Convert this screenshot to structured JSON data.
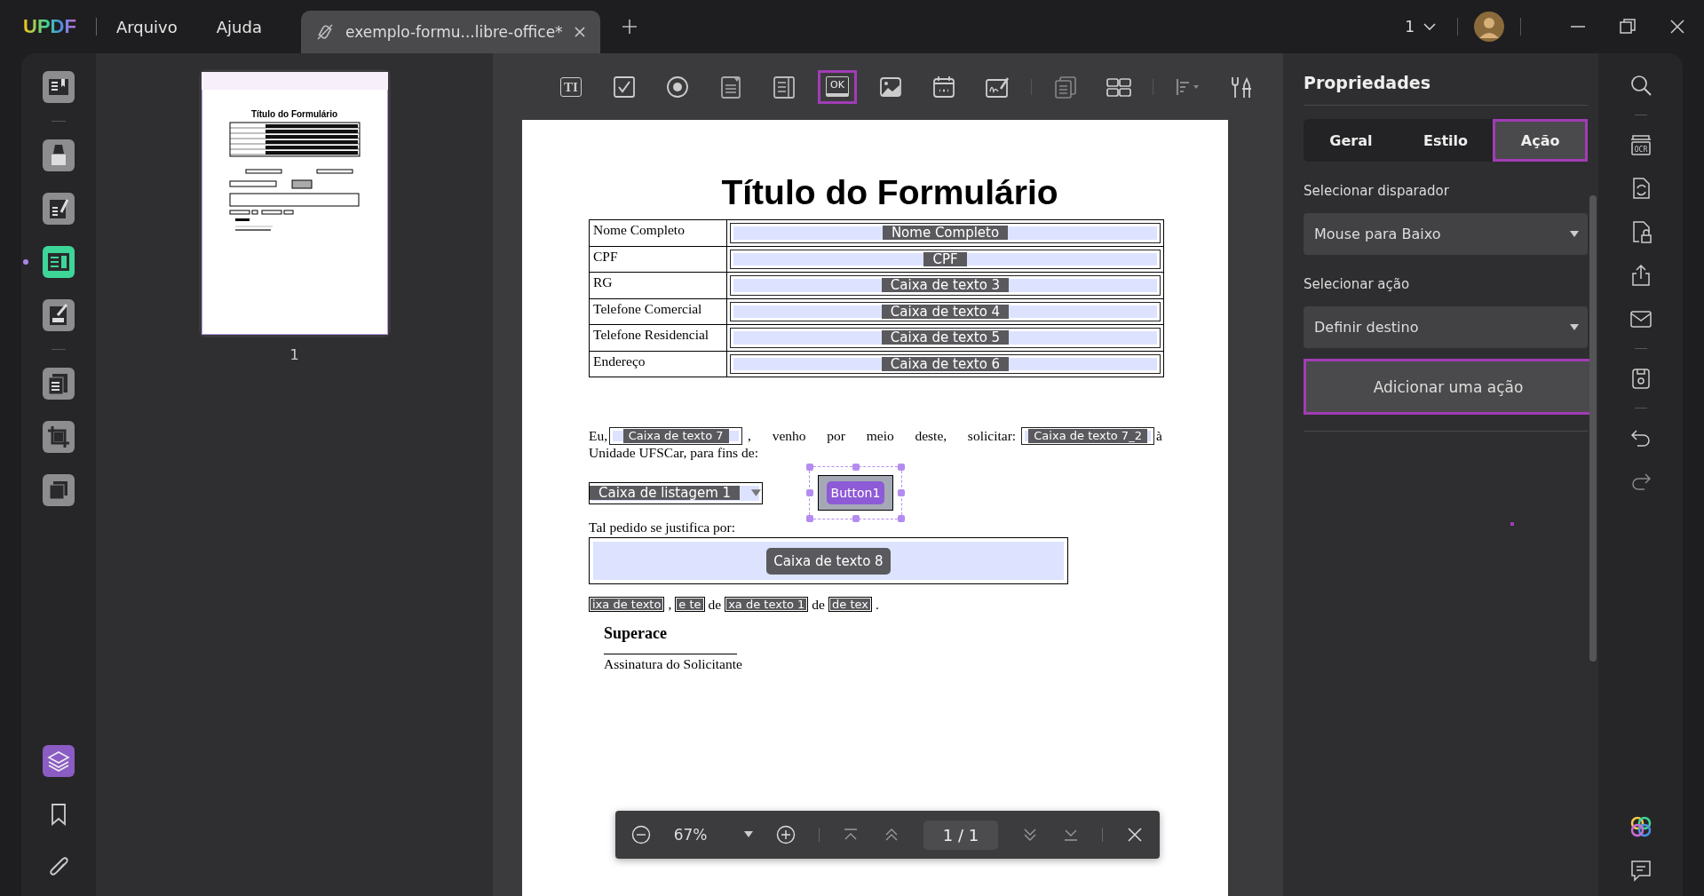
{
  "app": {
    "logo": "UPDF",
    "menu": [
      "Arquivo",
      "Ajuda"
    ]
  },
  "tabs": [
    {
      "title": "exemplo-formu...libre-office*",
      "selected": true
    }
  ],
  "window_count": "1",
  "left_tools": [
    {
      "kind": "reader",
      "selected": false
    },
    {
      "kind": "highlighter",
      "selected": false
    },
    {
      "kind": "edit",
      "selected": false
    },
    {
      "kind": "form",
      "selected": true
    },
    {
      "kind": "fill-sign",
      "selected": false
    },
    {
      "kind": "organize",
      "selected": false
    },
    {
      "kind": "crop",
      "selected": false
    },
    {
      "kind": "pages",
      "selected": false
    }
  ],
  "left_bottom_tools": [
    {
      "kind": "layers",
      "selected": true
    },
    {
      "kind": "bookmark",
      "selected": false
    },
    {
      "kind": "attachment",
      "selected": false
    }
  ],
  "thumbnails": [
    {
      "title": "Título do Formulário",
      "label": "1",
      "selected": true
    }
  ],
  "form_tools": [
    {
      "kind": "text-field",
      "label": "TI",
      "selected": false
    },
    {
      "kind": "checkbox",
      "selected": false
    },
    {
      "kind": "radio",
      "selected": false
    },
    {
      "kind": "dropdown",
      "selected": false
    },
    {
      "kind": "listbox",
      "selected": false
    },
    {
      "kind": "button",
      "label": "OK",
      "selected": true
    },
    {
      "kind": "image",
      "selected": false
    },
    {
      "kind": "date",
      "selected": false
    },
    {
      "kind": "signature",
      "selected": false
    },
    {
      "kind": "separator"
    },
    {
      "kind": "duplicate",
      "selected": false
    },
    {
      "kind": "grid",
      "selected": false
    },
    {
      "kind": "separator"
    },
    {
      "kind": "align",
      "selected": false
    },
    {
      "kind": "tools",
      "selected": false
    }
  ],
  "document": {
    "title": "Título do Formulário",
    "rows": [
      {
        "label": "Nome Completo",
        "field": "Nome Completo"
      },
      {
        "label": "CPF",
        "field": "CPF"
      },
      {
        "label": "RG",
        "field": "Caixa de texto 3"
      },
      {
        "label": "Telefone Comercial",
        "field": "Caixa de texto 4"
      },
      {
        "label": "Telefone Residencial",
        "field": "Caixa de texto 5"
      },
      {
        "label": "Endereço",
        "field": "Caixa de texto 6"
      }
    ],
    "request": {
      "before": "Eu,",
      "field_1": "Caixa de texto 7",
      "middle": ", venho por meio deste, solicitar:",
      "field_2": "Caixa de texto 7_2",
      "after": "à",
      "second_line": "Unidade UFSCar, para fins de:"
    },
    "list_box": "Caixa de listagem 1",
    "button": {
      "label": "Button1",
      "selected": true
    },
    "reason_label": "Tal pedido se justifica por:",
    "reason_field": "Caixa de texto 8",
    "date_line": [
      {
        "kind": "field",
        "text": "ixa de texto"
      },
      {
        "kind": "text",
        "text": ","
      },
      {
        "kind": "field",
        "text": "e te"
      },
      {
        "kind": "text",
        "text": "de"
      },
      {
        "kind": "field",
        "text": "xa de texto 1"
      },
      {
        "kind": "text",
        "text": "de"
      },
      {
        "kind": "field",
        "text": "de tex"
      },
      {
        "kind": "text",
        "text": "."
      }
    ],
    "signer": "Superace",
    "signature_caption": "Assinatura do Solicitante"
  },
  "zoom_bar": {
    "zoom": "67%",
    "page": "1 / 1"
  },
  "properties": {
    "title": "Propriedades",
    "tabs": [
      {
        "label": "Geral",
        "selected": false
      },
      {
        "label": "Estilo",
        "selected": false
      },
      {
        "label": "Ação",
        "selected": true
      }
    ],
    "trigger_label": "Selecionar disparador",
    "trigger_value": "Mouse para Baixo",
    "action_label": "Selecionar ação",
    "action_value": "Definir destino",
    "add_button": {
      "label": "Adicionar uma ação",
      "highlighted": true
    }
  },
  "right_tools": [
    {
      "kind": "search"
    },
    {
      "kind": "separator"
    },
    {
      "kind": "ocr",
      "label": "OCR"
    },
    {
      "kind": "convert"
    },
    {
      "kind": "protect"
    },
    {
      "kind": "share"
    },
    {
      "kind": "mail"
    },
    {
      "kind": "separator"
    },
    {
      "kind": "save"
    },
    {
      "kind": "separator"
    },
    {
      "kind": "undo"
    },
    {
      "kind": "redo"
    }
  ],
  "right_bottom_tools": [
    {
      "kind": "ai"
    },
    {
      "kind": "comment"
    }
  ]
}
